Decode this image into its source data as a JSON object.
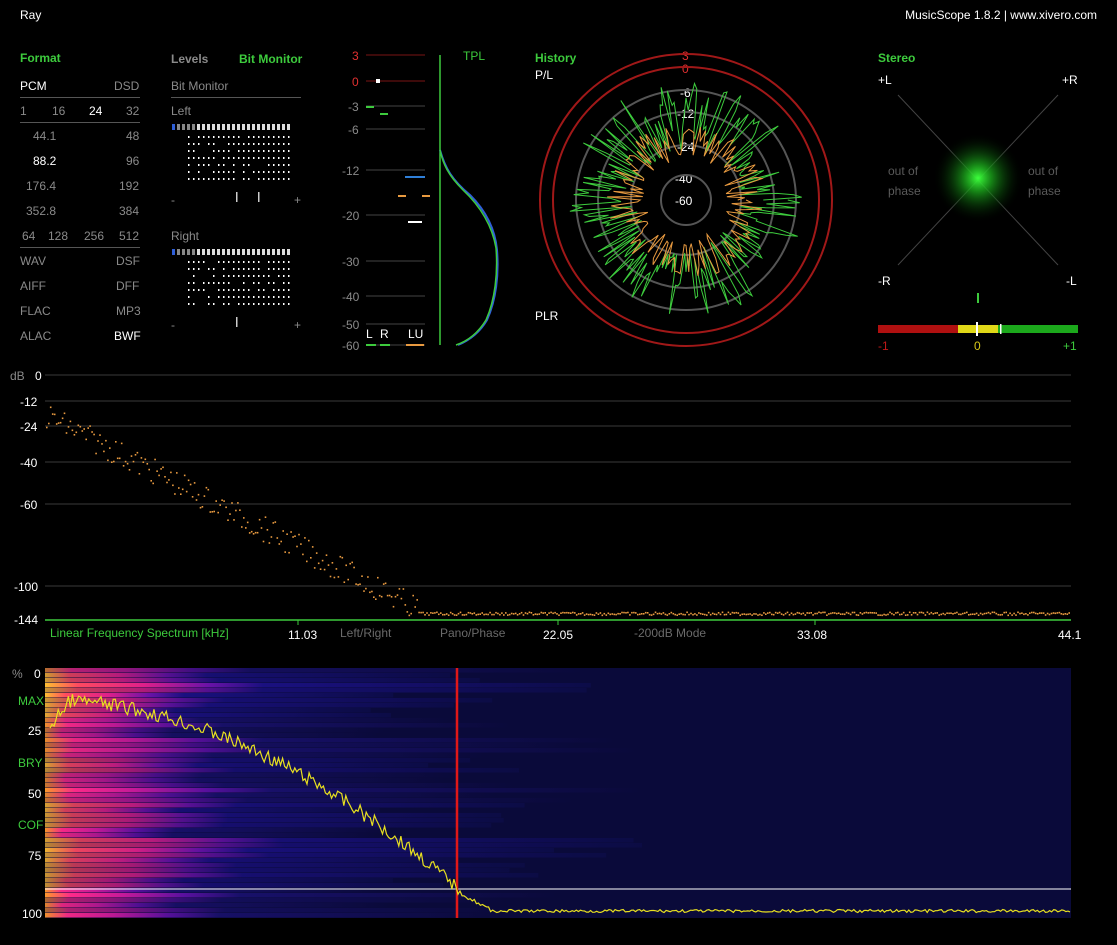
{
  "window": {
    "title": "Ray",
    "app_info": "MusicScope 1.8.2 | www.xivero.com"
  },
  "format": {
    "heading": "Format",
    "pcm": "PCM",
    "dsd": "DSD",
    "bits": [
      "1",
      "16",
      "24",
      "32"
    ],
    "rates_left": [
      "44.1",
      "88.2",
      "176.4",
      "352.8"
    ],
    "rates_right": [
      "48",
      "96",
      "192",
      "384"
    ],
    "dsd_rates": [
      "64",
      "128",
      "256",
      "512"
    ],
    "files_left": [
      "WAV",
      "AIFF",
      "FLAC",
      "ALAC"
    ],
    "files_right": [
      "DSF",
      "DFF",
      "MP3",
      "BWF"
    ]
  },
  "levels": {
    "tab_levels": "Levels",
    "tab_bitmonitor": "Bit Monitor",
    "bit_monitor_title": "Bit Monitor",
    "left_label": "Left",
    "right_label": "Right",
    "minus": "-",
    "plus": "+"
  },
  "meter": {
    "scale": [
      "3",
      "0",
      "-3",
      "-6",
      "-12",
      "-20",
      "-30",
      "-40",
      "-50",
      "-60"
    ],
    "channels": [
      "L",
      "R",
      "LU"
    ],
    "tpl": "TPL"
  },
  "history": {
    "heading": "History",
    "pl": "P/L",
    "plr": "PLR",
    "rings": [
      "3",
      "0",
      "-6",
      "-12",
      "-24",
      "-40",
      "-60"
    ]
  },
  "stereo": {
    "heading": "Stereo",
    "plus_l": "+L",
    "plus_r": "+R",
    "minus_r": "-R",
    "minus_l": "-L",
    "out_of_phase_left": [
      "out of",
      "phase"
    ],
    "out_of_phase_right": [
      "out of",
      "phase"
    ],
    "correlation_labels": [
      "-1",
      "0",
      "+1"
    ],
    "correlation_value": 0
  },
  "spectrum": {
    "db_unit": "dB",
    "db_ticks": [
      "0",
      "-12",
      "-24",
      "-40",
      "-60",
      "-100",
      "-144"
    ],
    "title": "Linear Frequency Spectrum [kHz]",
    "x_ticks": [
      "11.03",
      "22.05",
      "33.08",
      "44.1"
    ],
    "modes": [
      "Left/Right",
      "Pano/Phase",
      "-200dB Mode"
    ]
  },
  "spectrogram": {
    "unit": "%",
    "ticks": [
      "0",
      "25",
      "50",
      "75",
      "100"
    ],
    "markers": [
      "MAX",
      "BRY",
      "COF"
    ]
  },
  "colors": {
    "accent_green": "#3dcb3d",
    "red": "#c01818",
    "yellow": "#e8e020",
    "orange": "#e89a40",
    "blue": "#2f5fd8"
  }
}
